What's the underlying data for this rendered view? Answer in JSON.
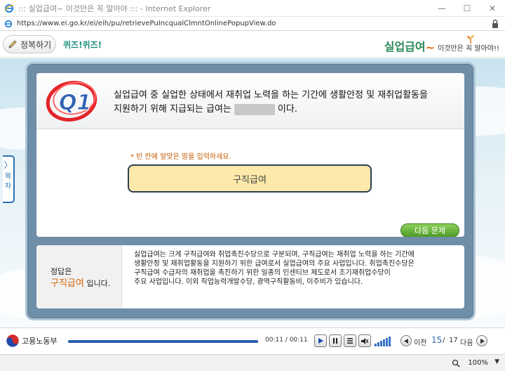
{
  "window": {
    "title": "::: 실업급여~ 이것만은 꼭 알아야 ::: - Internet Explorer",
    "url": "https://www.ei.go.kr/ei/eih/pu/retrievePuIncqualClmntOnlinePopupView.do",
    "minimize": "—",
    "maximize": "☐",
    "close": "✕"
  },
  "header": {
    "summary_label": "정복하기",
    "quiz_tab": "퀴즈!퀴즈!",
    "brand_main": "실업급여",
    "brand_tilde": "~",
    "brand_sub": "이것만은 꼭 알아야!!"
  },
  "side_tab": {
    "arrow": "〉",
    "label": "목차"
  },
  "question": {
    "badge": "Q1",
    "line1": "실업급여 중 실업한 상태에서 재취업 노력을 하는 기간에 생활안정 및 재취업활동을",
    "line2_before": "지원하기 위해 지급되는 급여는",
    "line2_after": "이다.",
    "instruction": "* 빈 칸에 알맞은 말을 입력하세요.",
    "answer_value": "구직급여",
    "next_label": "다음 문제"
  },
  "answer": {
    "label_line1": "정답은",
    "answer_word": "구직급여",
    "label_suffix": " 입니다.",
    "explanation": [
      "실업급여는 크게 구직급여와 취업촉진수당으로 구분되며, 구직급여는 재취업 노력을 하는 기간에",
      "생활안정 및 재취업활동을 지원하기 위한 급여로서 실업급여의 주요 사업입니다. 취업촉진수당은",
      "구직급여 수급자의 재취업을 촉진하기 위한 일종의 인센티브 제도로서 조기재취업수당이",
      "주요 사업입니다. 이외 직업능력개발수당, 광역구직활동비, 이주비가 있습니다."
    ]
  },
  "player": {
    "logo_text": "고용노동부",
    "progress": 1.0,
    "time": "00:11 / 00:11",
    "prev_label": "이전",
    "current_page": "15",
    "separator": "/",
    "total_pages": "17",
    "next_label": "다음"
  },
  "status": {
    "zoom": "100%"
  },
  "colors": {
    "accent_blue": "#2d6fb2",
    "brand_green": "#2c8a5a",
    "answer_orange": "#d4680e",
    "next_green": "#4c9a25",
    "answer_box": "#fde9a9"
  }
}
